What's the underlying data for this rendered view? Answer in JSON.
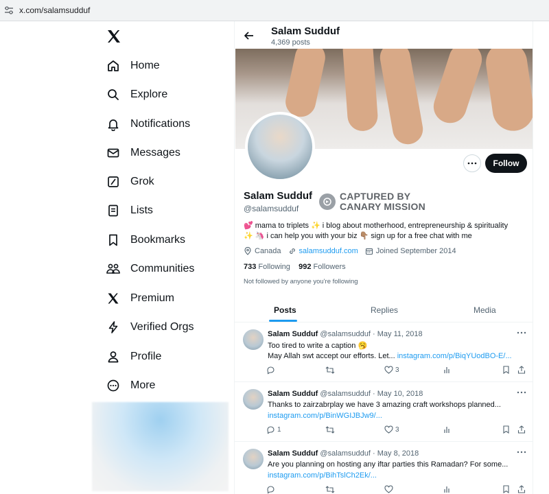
{
  "browser": {
    "url": "x.com/salamsudduf"
  },
  "nav": {
    "items": [
      {
        "label": "Home",
        "icon": "home-icon"
      },
      {
        "label": "Explore",
        "icon": "search-icon"
      },
      {
        "label": "Notifications",
        "icon": "bell-icon"
      },
      {
        "label": "Messages",
        "icon": "envelope-icon"
      },
      {
        "label": "Grok",
        "icon": "grok-icon"
      },
      {
        "label": "Lists",
        "icon": "list-icon"
      },
      {
        "label": "Bookmarks",
        "icon": "bookmark-icon"
      },
      {
        "label": "Communities",
        "icon": "communities-icon"
      },
      {
        "label": "Premium",
        "icon": "x-logo-icon"
      },
      {
        "label": "Verified Orgs",
        "icon": "lightning-icon"
      },
      {
        "label": "Profile",
        "icon": "person-icon"
      },
      {
        "label": "More",
        "icon": "more-circle-icon"
      }
    ]
  },
  "header": {
    "name": "Salam Sudduf",
    "posts_count": "4,369 posts"
  },
  "profile": {
    "name": "Salam Sudduf",
    "handle": "@salamsudduf",
    "overlay_line1": "CAPTURED BY",
    "overlay_line2": "CANARY MISSION",
    "follow_label": "Follow",
    "bio_line1": "💕 mama to triplets ✨ i blog about motherhood, entrepreneurship & spirituality",
    "bio_line2": "✨ 🦄 i can help you with your biz 👇🏽 sign up for a free chat with me",
    "location": "Canada",
    "website": "salamsudduf.com",
    "joined": "Joined September 2014",
    "following_count": "733",
    "following_label": "Following",
    "followers_count": "992",
    "followers_label": "Followers",
    "not_followed": "Not followed by anyone you're following"
  },
  "tabs": [
    {
      "label": "Posts"
    },
    {
      "label": "Replies"
    },
    {
      "label": "Media"
    }
  ],
  "posts": [
    {
      "name": "Salam Sudduf",
      "handle": "@salamsudduf",
      "date": "· May 11, 2018",
      "line1": "Too tired to write a caption 🥱",
      "line2": "May Allah swt accept our efforts. Let... ",
      "link": "instagram.com/p/BiqYUodBO-E/...",
      "replies": "",
      "reposts": "",
      "likes": "3"
    },
    {
      "name": "Salam Sudduf",
      "handle": "@salamsudduf",
      "date": "· May 10, 2018",
      "line1": "Thanks to zairzabrplay we have 3 amazing craft workshops planned...",
      "line2": "",
      "link": "instagram.com/p/BinWGIJBJw9/...",
      "replies": "1",
      "reposts": "",
      "likes": "3"
    },
    {
      "name": "Salam Sudduf",
      "handle": "@salamsudduf",
      "date": "· May 8, 2018",
      "line1": "Are you planning on hosting any iftar parties this Ramadan? For some...",
      "line2": "",
      "link": "instagram.com/p/BihTslCh2Ek/...",
      "replies": "",
      "reposts": "",
      "likes": ""
    }
  ],
  "colors": {
    "accent": "#1d9bf0",
    "text": "#0f1419",
    "secondary": "#536471",
    "follow_bg": "#0f1419"
  }
}
